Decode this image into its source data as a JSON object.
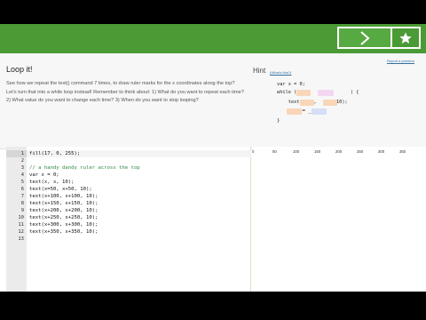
{
  "colors": {
    "topbar_green": "#4a9a35",
    "comment_green": "#2e8b45",
    "link_blue": "#3470a0"
  },
  "progress": {
    "arrow_icon": "chevron-right-icon",
    "star_icon": "star-icon"
  },
  "challenge": {
    "title": "Loop it!",
    "body": "See how we repeat the text() command 7 times, to draw ruler marks for the x coordinates along the top? Let's turn that into a while loop instead! Remember to think about: 1) What do you want to repeat each time? 2) What value do you want to change each time? 3) When do you want to stop looping?",
    "report_link": "Report a problem"
  },
  "hint": {
    "title": "Hint",
    "whats_this": "(What's this?)",
    "lines": [
      "var x = 0;",
      "while (         <         ) {",
      "    text(    ,     , 10);",
      "    ___ += ___;",
      "}"
    ]
  },
  "editor": {
    "line_numbers": [
      "1",
      "2",
      "3",
      "4",
      "5",
      "6",
      "7",
      "8",
      "9",
      "10",
      "11",
      "12",
      "13"
    ],
    "lines": [
      "fill(17, 0, 255);",
      "",
      "// a handy dandy ruler across the top",
      "var x = 0;",
      "text(x, x, 10);",
      "text(x=50, x+50, 10);",
      "text(x+100, x+100, 10);",
      "text(x+150, x+150, 10);",
      "text(x+200, x+200, 10);",
      "text(x+250, x+250, 10);",
      "text(x+300, x+300, 10);",
      "text(x+350, x+350, 10);",
      ""
    ]
  },
  "canvas": {
    "ruler_ticks": [
      "0",
      "50",
      "100",
      "150",
      "200",
      "250",
      "300",
      "350"
    ]
  }
}
